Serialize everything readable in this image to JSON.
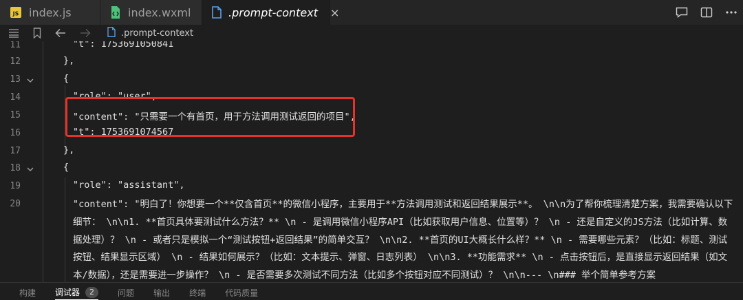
{
  "tabs": [
    {
      "label": "index.js",
      "icon": "js-file-icon"
    },
    {
      "label": "index.wxml",
      "icon": "wxml-file-icon"
    },
    {
      "label": ".prompt-context",
      "icon": "file-icon",
      "close": "×"
    }
  ],
  "breadcrumb": {
    "file": ".prompt-context"
  },
  "lines": [
    {
      "n": "11",
      "text": "\"t\": 1753691050841"
    },
    {
      "n": "12",
      "text": "},"
    },
    {
      "n": "13",
      "text": "{"
    },
    {
      "n": "14",
      "text": "\"role\": \"user\","
    },
    {
      "n": "15",
      "text": "\"content\": \"只需要一个有首页，用于方法调用测试返回的项目\","
    },
    {
      "n": "16",
      "text": "\"t\": 1753691074567"
    },
    {
      "n": "17",
      "text": "},"
    },
    {
      "n": "18",
      "text": "{"
    },
    {
      "n": "19",
      "text": "\"role\": \"assistant\","
    },
    {
      "n": "20",
      "text": "\"content\": \"明白了！你想要一个**仅含首页**的微信小程序，主要用于**方法调用测试和返回结果展示**。  \\n\\n为了帮你梳理清楚方案，我需要确认以下细节：  \\n\\n1. **首页具体要测试什么方法？**  \\n   - 是调用微信小程序API（比如获取用户信息、位置等）？  \\n   - 还是自定义的JS方法（比如计算、数据处理）？  \\n   - 或者只是模拟一个“测试按钮+返回结果”的简单交互？  \\n\\n2. **首页的UI大概长什么样？**  \\n   - 需要哪些元素？（比如：标题、测试按钮、结果显示区域）  \\n   - 结果如何展示？（比如：文本提示、弹窗、日志列表）  \\n\\n3. **功能需求**  \\n   - 点击按钮后，是直接显示返回结果（如文本/数据），还是需要进一步操作？  \\n   - 是否需要多次测试不同方法（比如多个按钮对应不同测试）？  \\n\\n---  \\n### 举个简单参考方案"
    }
  ],
  "panel_tabs": [
    {
      "label": "构建"
    },
    {
      "label": "调试器",
      "badge": "2"
    },
    {
      "label": "问题"
    },
    {
      "label": "输出"
    },
    {
      "label": "终端"
    },
    {
      "label": "代码质量"
    }
  ],
  "colors": {
    "highlight_box": "#e5332a",
    "js_icon": "#e8c53a",
    "wxml_icon": "#4ec27a",
    "file_icon": "#5aa0e8"
  }
}
